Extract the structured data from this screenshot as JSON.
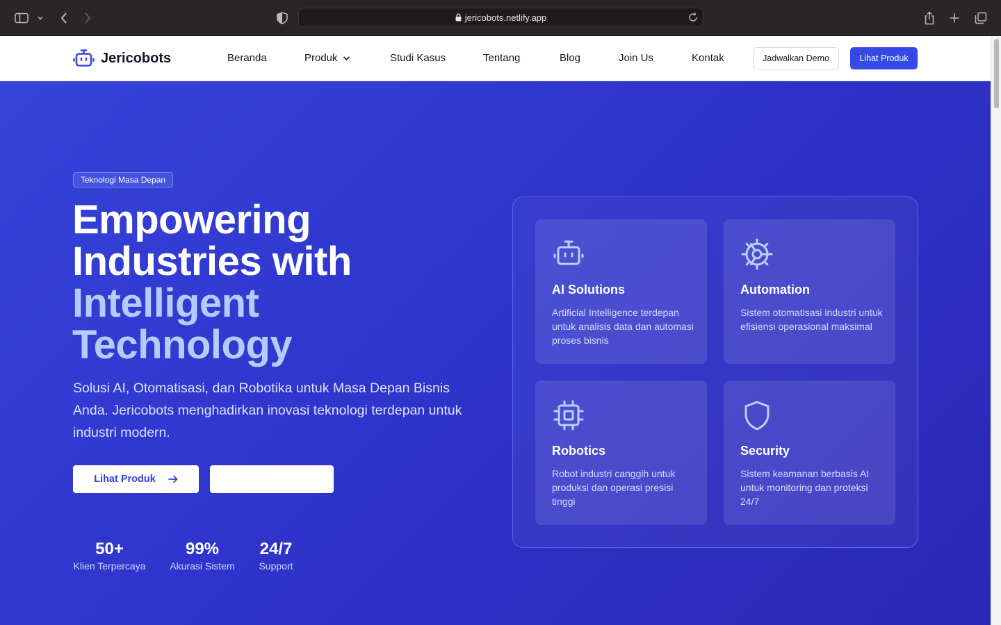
{
  "browser": {
    "url": "jericobots.netlify.app"
  },
  "nav": {
    "brand": "Jericobots",
    "items": [
      {
        "label": "Beranda"
      },
      {
        "label": "Produk"
      },
      {
        "label": "Studi Kasus"
      },
      {
        "label": "Tentang"
      },
      {
        "label": "Blog"
      },
      {
        "label": "Join Us"
      },
      {
        "label": "Kontak"
      }
    ],
    "demo_button": "Jadwalkan Demo",
    "product_button": "Lihat Produk"
  },
  "hero": {
    "tag": "Teknologi Masa Depan",
    "title_line1": "Empowering",
    "title_line2": "Industries with",
    "title_accent1": "Intelligent",
    "title_accent2": "Technology",
    "description": "Solusi AI, Otomatisasi, dan Robotika untuk Masa Depan Bisnis Anda. Jericobots menghadirkan inovasi teknologi terdepan untuk industri modern.",
    "cta_primary": "Lihat Produk",
    "cta_secondary": "",
    "stats": [
      {
        "value": "50+",
        "label": "Klien Terpercaya"
      },
      {
        "value": "99%",
        "label": "Akurasi Sistem"
      },
      {
        "value": "24/7",
        "label": "Support"
      }
    ]
  },
  "features": [
    {
      "icon": "robot-icon",
      "title": "AI Solutions",
      "desc": "Artificial Intelligence terdepan untuk analisis data dan automasi proses bisnis"
    },
    {
      "icon": "gear-icon",
      "title": "Automation",
      "desc": "Sistem otomatisasi industri untuk efisiensi operasional maksimal"
    },
    {
      "icon": "chip-icon",
      "title": "Robotics",
      "desc": "Robot industri canggih untuk produksi dan operasi presisi tinggi"
    },
    {
      "icon": "shield-icon",
      "title": "Security",
      "desc": "Sistem keamanan berbasis AI untuk monitoring dan proteksi 24/7"
    }
  ],
  "colors": {
    "primary": "#3449e6",
    "hero_start": "#3644da",
    "hero_end": "#2a28b6",
    "accent_text": "#b4cbfb"
  }
}
